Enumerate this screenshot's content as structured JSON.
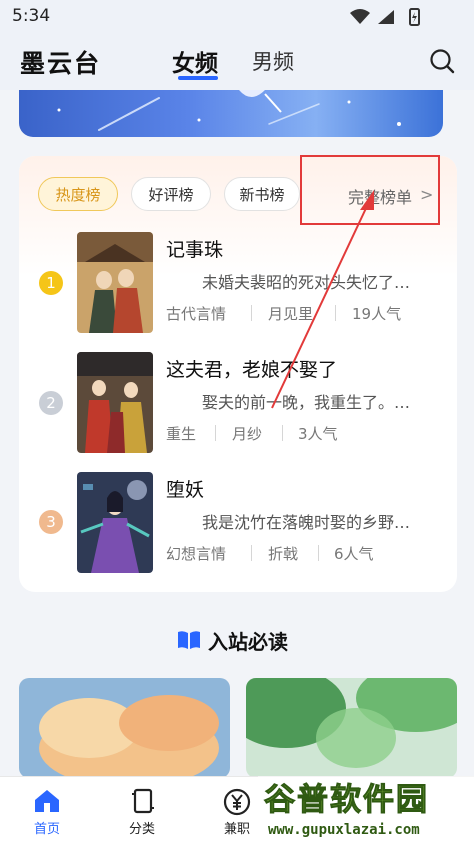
{
  "status": {
    "time": "5:34"
  },
  "header": {
    "brand": "墨云台",
    "tab_female": "女频",
    "tab_male": "男频"
  },
  "ranking": {
    "tabs": [
      "热度榜",
      "好评榜",
      "新书榜"
    ],
    "full_list": "完整榜单",
    "items": [
      {
        "rank": "1",
        "title": "记事珠",
        "desc": "未婚夫裴昭的死对头失忆了…",
        "genre": "古代言情",
        "author": "月见里",
        "popularity": "19人气"
      },
      {
        "rank": "2",
        "title": "这夫君，老娘不娶了",
        "desc": "娶夫的前一晚，我重生了。…",
        "genre": "重生",
        "author": "月纱",
        "popularity": "3人气"
      },
      {
        "rank": "3",
        "title": "堕妖",
        "desc": "我是沈竹在落魄时娶的乡野…",
        "genre": "幻想言情",
        "author": "折戟",
        "popularity": "6人气"
      }
    ]
  },
  "section": {
    "title": "入站必读"
  },
  "nav": {
    "home": "首页",
    "category": "分类",
    "part_time": "兼职"
  },
  "watermark": {
    "text": "谷普软件园",
    "url": "www.gupuxlazai.com"
  },
  "colors": {
    "accent": "#2a66ff",
    "rank1": "#f5c518",
    "rank2": "#c9ced6",
    "rank3": "#f0b98e",
    "annotation": "#e23a3a"
  }
}
